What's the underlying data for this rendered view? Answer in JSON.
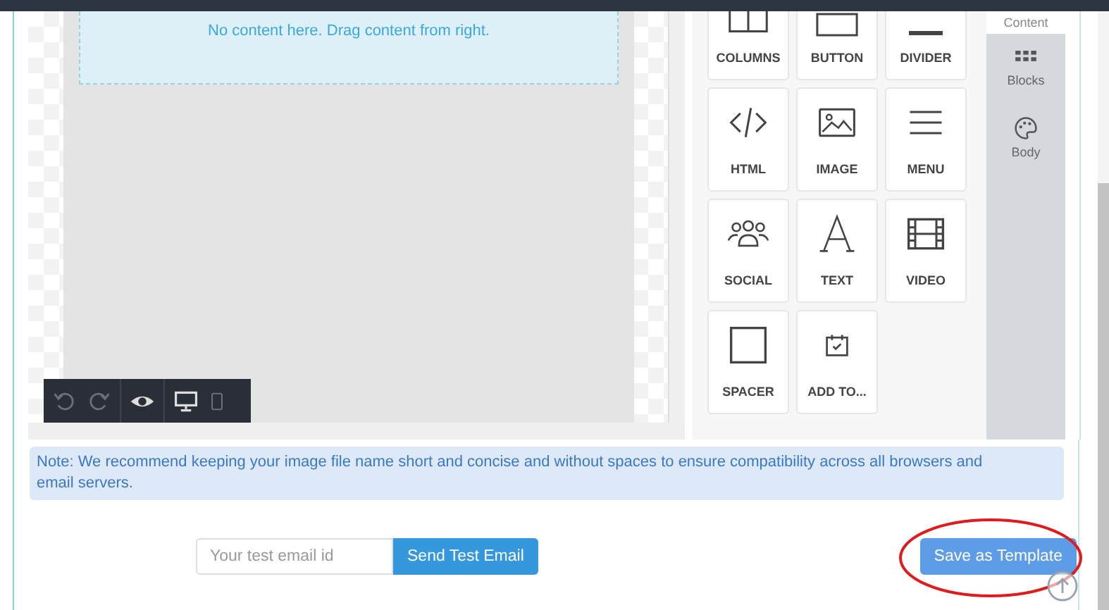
{
  "canvas": {
    "empty_message": "No content here. Drag content from right."
  },
  "content_tiles": [
    {
      "kind": "columns",
      "label": "COLUMNS"
    },
    {
      "kind": "button",
      "label": "BUTTON"
    },
    {
      "kind": "divider",
      "label": "DIVIDER"
    },
    {
      "kind": "html",
      "label": "HTML"
    },
    {
      "kind": "image",
      "label": "IMAGE"
    },
    {
      "kind": "menu",
      "label": "MENU"
    },
    {
      "kind": "social",
      "label": "SOCIAL"
    },
    {
      "kind": "text",
      "label": "TEXT"
    },
    {
      "kind": "video",
      "label": "VIDEO"
    },
    {
      "kind": "spacer",
      "label": "SPACER"
    },
    {
      "kind": "calendar",
      "label": "ADD TO..."
    }
  ],
  "side_tabs": [
    {
      "kind": "content",
      "label": "Content"
    },
    {
      "kind": "blocks",
      "label": "Blocks"
    },
    {
      "kind": "body",
      "label": "Body"
    }
  ],
  "note": "Note: We recommend keeping your image file name short and concise and without spaces to ensure compatibility across all browsers and email servers.",
  "test_email": {
    "placeholder": "Your test email id",
    "button": "Send Test Email"
  },
  "save_button": "Save as Template"
}
